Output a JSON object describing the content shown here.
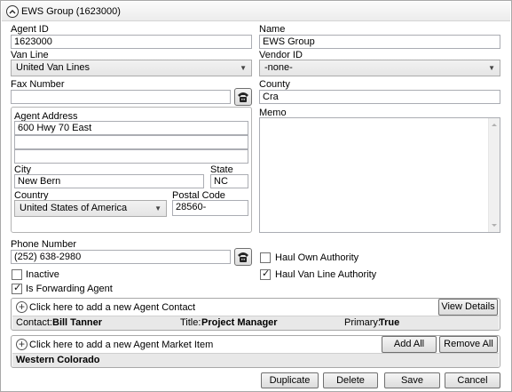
{
  "header": {
    "title": "EWS Group  (1623000)"
  },
  "fields": {
    "agent_id_label": "Agent ID",
    "agent_id_value": "1623000",
    "name_label": "Name",
    "name_value": "EWS Group",
    "van_line_label": "Van Line",
    "van_line_value": "United Van Lines",
    "vendor_id_label": "Vendor ID",
    "vendor_id_value": "-none-",
    "fax_label": "Fax Number",
    "fax_value": "",
    "county_label": "County",
    "county_value": "Cra",
    "memo_label": "Memo",
    "phone_label": "Phone Number",
    "phone_value": "(252) 638-2980"
  },
  "address": {
    "group_label": "Agent Address",
    "line1": "600 Hwy 70 East",
    "line2": "",
    "line3": "",
    "city_label": "City",
    "city_value": "New Bern",
    "state_label": "State",
    "state_value": "NC",
    "country_label": "Country",
    "country_value": "United States of America",
    "postal_label": "Postal Code",
    "postal_value": "28560-"
  },
  "checkboxes": {
    "inactive_label": "Inactive",
    "inactive_checked": false,
    "forwarding_label": "Is Forwarding Agent",
    "forwarding_checked": true,
    "haul_own_label": "Haul Own Authority",
    "haul_own_checked": false,
    "haul_van_label": "Haul Van Line Authority",
    "haul_van_checked": true
  },
  "contacts": {
    "add_text": "Click here to add a new Agent Contact",
    "view_details": "View Details",
    "contact_label": "Contact:",
    "contact_name": "Bill Tanner",
    "title_label": "Title:",
    "title_value": "Project Manager",
    "primary_label": "Primary:",
    "primary_value": "True"
  },
  "market": {
    "add_text": "Click here to add a new Agent Market Item",
    "add_all": "Add All",
    "remove_all": "Remove All",
    "item": "Western Colorado"
  },
  "footer": {
    "duplicate": "Duplicate",
    "delete": "Delete",
    "save": "Save",
    "cancel": "Cancel"
  }
}
